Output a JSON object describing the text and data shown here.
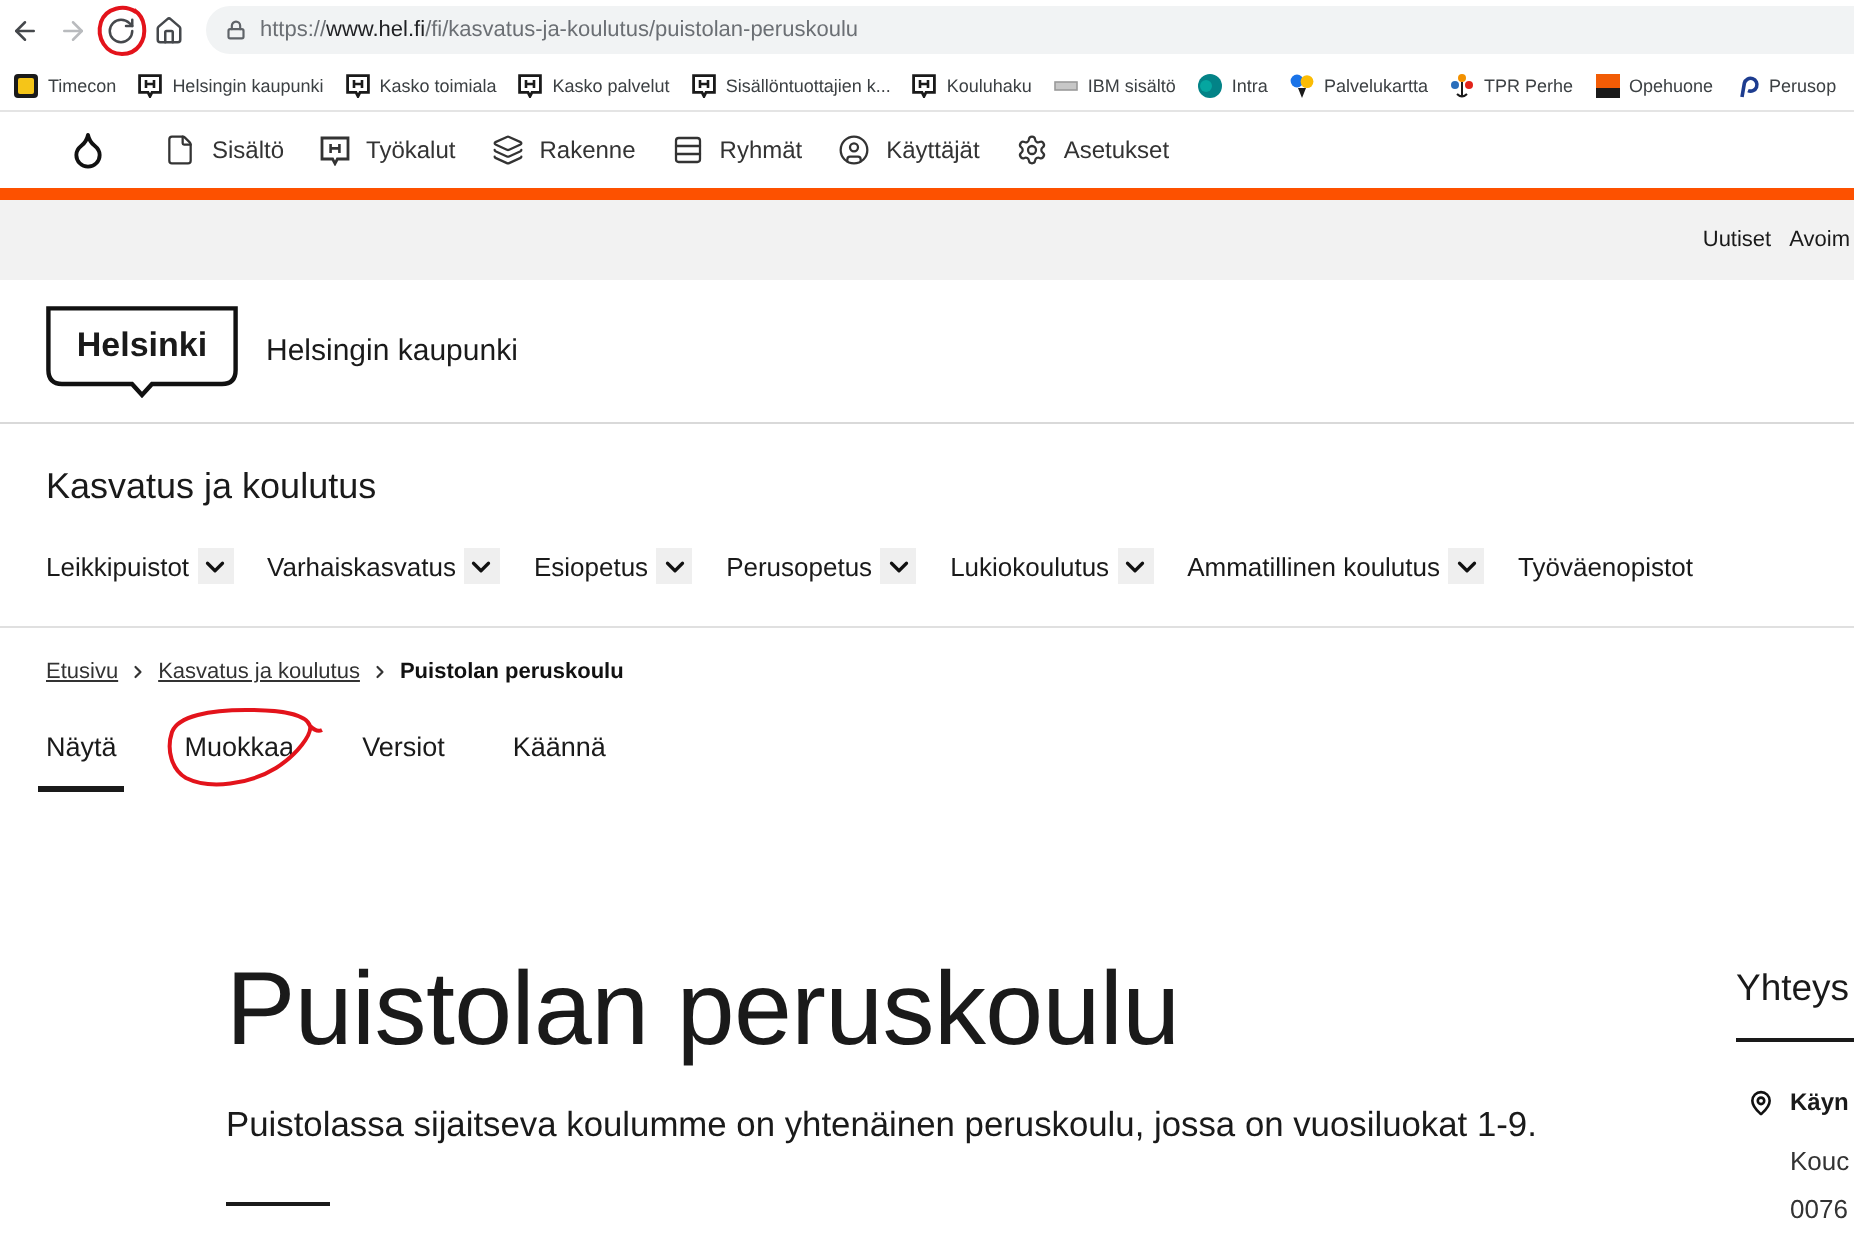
{
  "browser": {
    "nav_buttons": [
      {
        "kind": "back",
        "disabled": false,
        "circled": false
      },
      {
        "kind": "forward",
        "disabled": true,
        "circled": false
      },
      {
        "kind": "reload",
        "disabled": false,
        "circled": true
      },
      {
        "kind": "home",
        "disabled": false,
        "circled": false
      }
    ],
    "address": {
      "scheme": "https://",
      "host": "www.hel.fi",
      "path": "/fi/kasvatus-ja-koulutus/puistolan-peruskoulu"
    }
  },
  "bookmarks": [
    {
      "label": "Timecon",
      "kind": "tile"
    },
    {
      "label": "Helsingin kaupunki",
      "kind": "shield"
    },
    {
      "label": "Kasko toimiala",
      "kind": "shield"
    },
    {
      "label": "Kasko palvelut",
      "kind": "shield"
    },
    {
      "label": "Sisällöntuottajien k...",
      "kind": "shield"
    },
    {
      "label": "Kouluhaku",
      "kind": "shield"
    },
    {
      "label": "IBM sisältö",
      "kind": "bar"
    },
    {
      "label": "Intra",
      "kind": "badge"
    },
    {
      "label": "Palvelukartta",
      "kind": "pins"
    },
    {
      "label": "TPR Perhe",
      "kind": "dots"
    },
    {
      "label": "Opehuone",
      "kind": "block"
    },
    {
      "label": "Perusop",
      "kind": "loop"
    }
  ],
  "admin_toolbar": {
    "items": [
      {
        "label": "Sisältö",
        "kind": "content"
      },
      {
        "label": "Työkalut",
        "kind": "tools"
      },
      {
        "label": "Rakenne",
        "kind": "structure"
      },
      {
        "label": "Ryhmät",
        "kind": "groups"
      },
      {
        "label": "Käyttäjät",
        "kind": "users"
      },
      {
        "label": "Asetukset",
        "kind": "settings"
      }
    ]
  },
  "utility_links": [
    "Uutiset",
    "Avoim"
  ],
  "header": {
    "logo_text": "Helsinki",
    "site_name": "Helsingin kaupunki"
  },
  "section": {
    "title": "Kasvatus ja koulutus",
    "nav": [
      {
        "label": "Leikkipuistot",
        "kind": "menu"
      },
      {
        "label": "Varhaiskasvatus",
        "kind": "menu"
      },
      {
        "label": "Esiopetus",
        "kind": "menu"
      },
      {
        "label": "Perusopetus",
        "kind": "menu"
      },
      {
        "label": "Lukiokoulutus",
        "kind": "menu"
      },
      {
        "label": "Ammatillinen koulutus",
        "kind": "menu"
      },
      {
        "label": "Työväenopistot",
        "kind": "link"
      }
    ]
  },
  "breadcrumb": [
    {
      "label": "Etusivu",
      "current": false
    },
    {
      "label": "Kasvatus ja koulutus",
      "current": false
    },
    {
      "label": "Puistolan peruskoulu",
      "current": true
    }
  ],
  "tabs": [
    {
      "label": "Näytä",
      "selected": true,
      "circled": false
    },
    {
      "label": "Muokkaa",
      "selected": false,
      "circled": true
    },
    {
      "label": "Versiot",
      "selected": false,
      "circled": false
    },
    {
      "label": "Käännä",
      "selected": false,
      "circled": false
    }
  ],
  "main": {
    "title": "Puistolan peruskoulu",
    "lead": "Puistolassa sijaitseva koulumme on yhtenäinen peruskoulu, jossa on vuosiluokat 1-9."
  },
  "sidebar": {
    "title": "Yhteys",
    "address_label": "Käyn",
    "address_lines": [
      "Kouc",
      "0076"
    ]
  }
}
